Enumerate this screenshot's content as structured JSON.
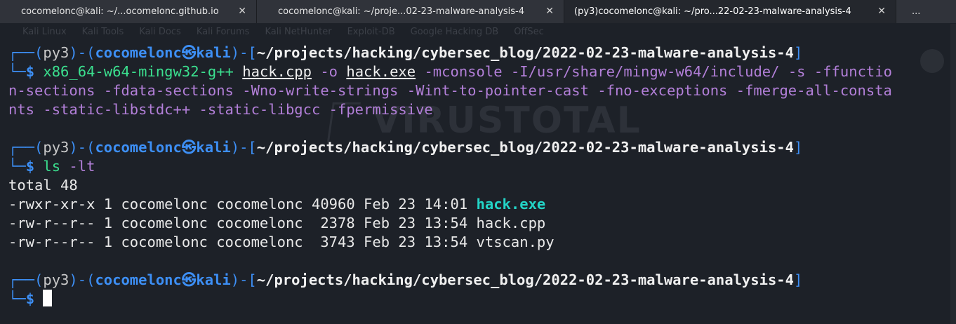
{
  "tabs": [
    {
      "title": "cocomelonc@kali: ~/...ocomelonc.github.io",
      "close": "✕"
    },
    {
      "title": "cocomelonc@kali: ~/proje...02-23-malware-analysis-4",
      "close": "✕"
    },
    {
      "title": "(py3)cocomelonc@kali: ~/pro...22-02-23-malware-analysis-4",
      "close": "✕"
    },
    {
      "title": "..."
    }
  ],
  "prompt": {
    "env": "py3",
    "user": "cocomelonc",
    "separator_icon": "㉿",
    "host": "kali",
    "path": "~/projects/hacking/cybersec_blog/2022-02-23-malware-analysis-4",
    "symbol": "$"
  },
  "commands": [
    {
      "program": "x86_64-w64-mingw32-g++",
      "args": {
        "file_in": "hack.cpp",
        "flag_o": "-o",
        "file_out": "hack.exe",
        "rest_line1": "-mconsole -I/usr/share/mingw-w64/include/ -s -ffunctio",
        "rest_line2": "n-sections -fdata-sections -Wno-write-strings -Wint-to-pointer-cast -fno-exceptions -fmerge-all-consta",
        "rest_line3": "nts -static-libstdc++ -static-libgcc -fpermissive"
      }
    },
    {
      "program": "ls",
      "args": "-lt"
    }
  ],
  "ls_output": {
    "total": "total 48",
    "rows": [
      {
        "perm": "-rwxr-xr-x",
        "links": "1",
        "owner": "cocomelonc",
        "group": "cocomelonc",
        "size": "40960",
        "month": "Feb",
        "day": "23",
        "time": "14:01",
        "name": "hack.exe",
        "executable": true
      },
      {
        "perm": "-rw-r--r--",
        "links": "1",
        "owner": "cocomelonc",
        "group": "cocomelonc",
        "size": " 2378",
        "month": "Feb",
        "day": "23",
        "time": "13:54",
        "name": "hack.cpp",
        "executable": false
      },
      {
        "perm": "-rw-r--r--",
        "links": "1",
        "owner": "cocomelonc",
        "group": "cocomelonc",
        "size": " 3743",
        "month": "Feb",
        "day": "23",
        "time": "13:54",
        "name": "vtscan.py",
        "executable": false
      }
    ]
  },
  "background": {
    "bookmarks": [
      "Kali Linux",
      "Kali Tools",
      "Kali Docs",
      "Kali Forums",
      "Kali NetHunter",
      "Exploit-DB",
      "Google Hacking DB",
      "OffSec"
    ],
    "logo_text": "VIRUSTOTAL"
  },
  "colors": {
    "terminal_bg": "#1d2128",
    "prompt_frame": "#3d8ff5",
    "prompt_path": "#f0f0f0",
    "command": "#3be08f",
    "argument": "#b27fd8",
    "executable_file": "#23d4c6"
  }
}
